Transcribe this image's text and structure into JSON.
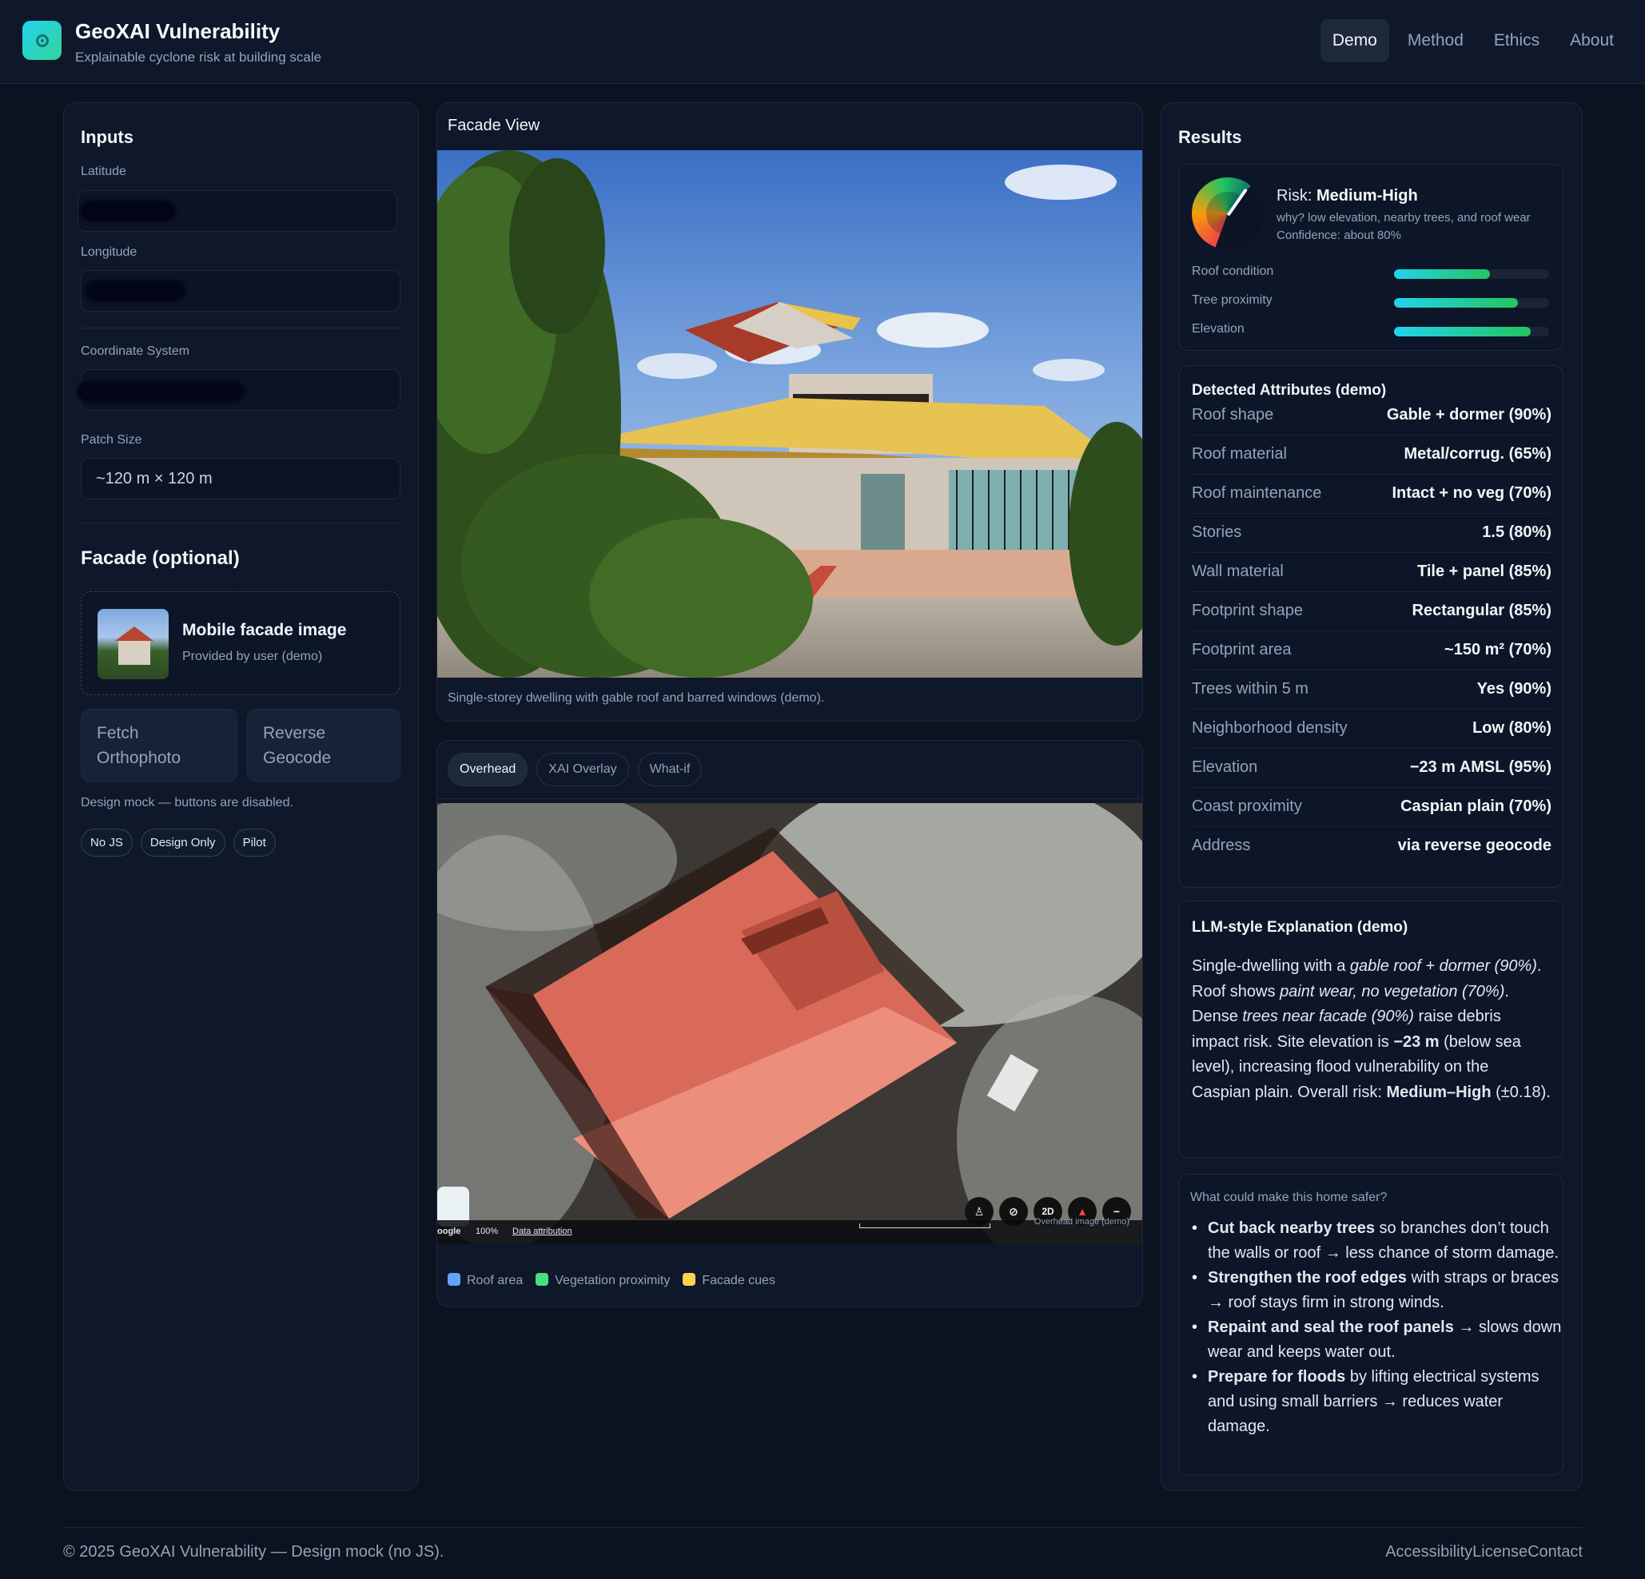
{
  "header": {
    "title": "GeoXAI Vulnerability",
    "subtitle": "Explainable cyclone risk at building scale",
    "nav": [
      {
        "label": "Demo",
        "active": true
      },
      {
        "label": "Method",
        "active": false
      },
      {
        "label": "Ethics",
        "active": false
      },
      {
        "label": "About",
        "active": false
      }
    ]
  },
  "inputs": {
    "title": "Inputs",
    "latitude_label": "Latitude",
    "longitude_label": "Longitude",
    "crs_label": "Coordinate System",
    "patch_label": "Patch Size",
    "patch_value": "~120 m × 120 m"
  },
  "facade": {
    "section_title": "Facade (optional)",
    "upload_title": "Mobile facade image",
    "upload_sub": "Provided by user (demo)",
    "fetch_button": "Fetch Orthophoto",
    "geocode_button": "Reverse Geocode",
    "note": "Design mock — buttons are disabled.",
    "chips": [
      "No JS",
      "Design Only",
      "Pilot"
    ]
  },
  "facade_view": {
    "title": "Facade View",
    "caption": "Single-storey dwelling with gable roof and barred windows (demo)."
  },
  "overhead": {
    "tabs": [
      {
        "label": "Overhead",
        "active": true
      },
      {
        "label": "XAI Overlay",
        "active": false
      },
      {
        "label": "What-if",
        "active": false
      }
    ],
    "map_google": "oogle",
    "map_zoom": "100%",
    "map_attribution": "Data attribution",
    "map_overlay": "Overhead image (demo)",
    "ctrl_2d": "2D",
    "legend": [
      {
        "label": "Roof area",
        "color": "#60a5fa"
      },
      {
        "label": "Vegetation proximity",
        "color": "#4ade80"
      },
      {
        "label": "Facade cues",
        "color": "#fcd34d"
      }
    ]
  },
  "results": {
    "title": "Results",
    "risk_prefix": "Risk:",
    "risk_value": "Medium-High",
    "why": "why? low elevation, nearby trees, and roof wear",
    "confidence": "Confidence: about 80%",
    "bars": [
      {
        "label": "Roof condition",
        "value": 0.62
      },
      {
        "label": "Tree proximity",
        "value": 0.8
      },
      {
        "label": "Elevation",
        "value": 0.88
      }
    ],
    "attributes_title": "Detected Attributes (demo)",
    "attributes": [
      {
        "k": "Roof shape",
        "v": "Gable + dormer (90%)"
      },
      {
        "k": "Roof material",
        "v": "Metal/corrug. (65%)"
      },
      {
        "k": "Roof maintenance",
        "v": "Intact + no veg (70%)"
      },
      {
        "k": "Stories",
        "v": "1.5 (80%)"
      },
      {
        "k": "Wall material",
        "v": "Tile + panel (85%)"
      },
      {
        "k": "Footprint shape",
        "v": "Rectangular (85%)"
      },
      {
        "k": "Footprint area",
        "v": "~150 m² (70%)"
      },
      {
        "k": "Trees within 5 m",
        "v": "Yes (90%)"
      },
      {
        "k": "Neighborhood density",
        "v": "Low (80%)"
      },
      {
        "k": "Elevation",
        "v": "−23 m AMSL (95%)"
      },
      {
        "k": "Coast proximity",
        "v": "Caspian plain (70%)"
      },
      {
        "k": "Address",
        "v": "via reverse geocode"
      }
    ],
    "explanation_title": "LLM-style Explanation (demo)",
    "explanation": {
      "t1": "Single-dwelling with a ",
      "e1": "gable roof + dormer (90%)",
      "t2": ". Roof shows ",
      "e2": "paint wear, no vegetation (70%)",
      "t3": ". Dense ",
      "e3": "trees near facade (90%)",
      "t4": " raise debris impact risk. Site elevation is ",
      "b1": "−23 m",
      "t5": " (below sea level), increasing flood vulnerability on the Caspian plain. Overall risk: ",
      "b2": "Medium–High",
      "t6": " (±0.18)."
    },
    "tips_title": "What could make this home safer?",
    "tips": [
      {
        "bold": "Cut back nearby trees",
        "rest": " so branches don’t touch the walls or roof → less chance of storm damage."
      },
      {
        "bold": "Strengthen the roof edges",
        "rest": " with straps or braces → roof stays firm in strong winds."
      },
      {
        "bold": "Repaint and seal the roof panels",
        "rest": " → slows down wear and keeps water out."
      },
      {
        "bold": "Prepare for floods",
        "rest": " by lifting electrical systems and using small barriers → reduces water damage."
      }
    ]
  },
  "footer": {
    "copyright": "© 2025 GeoXAI Vulnerability — Design mock (no JS).",
    "links": [
      "Accessibility",
      "License",
      "Contact"
    ]
  },
  "colors": {
    "background": "#0b1220",
    "panel": "#0f172a",
    "accent_start": "#22d3ee",
    "accent_end": "#22c55e"
  }
}
